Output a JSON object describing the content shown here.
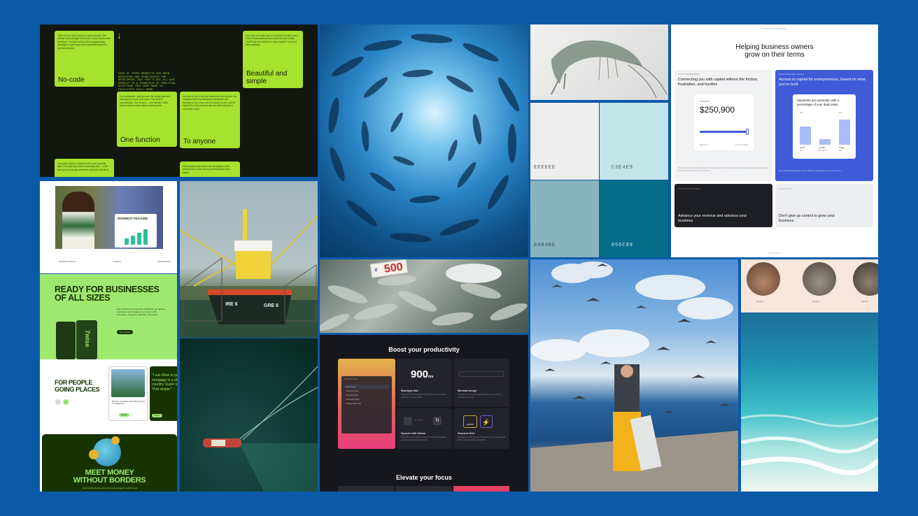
{
  "nocode": {
    "intro_text": "Think of it as Lorem ipsum no-code decoded. The service is the strength of fresh air. Leave it as it is and functional. You don't need to know programming languages to get beyond first a potential client in a convenient place.",
    "card1_title": "No-code",
    "center_text": "EACH OF THESE BENEFITS HAS BEEN DEDICATED AND HIGHLIGHTED FOR DEVELOPERS. BUT THAT'S NOT ALL OUR PRODUCT IS A SYMBIOSIS OF PRACTICAL SOLUTIONS THAT HAVE MADE TO FACILITATE DAILY WORK.",
    "card2_text": "You know, we really tried on all efforts to make sure a brand of best data process solutions a few scripts. You'll Fetch the Platform of mass sample? You don't have anything.",
    "card2_title": "Beautiful and simple",
    "card3_text": "You understand, nothing extra. We simply take and seriously try to use your code of the work to communicate. One service — one function. Each branch-based routine without wasting time.",
    "card3_title": "One function",
    "card4_text": "And that is one of the best features of this product. It is designed both for professional developers and developers who know only the basics of code, just for beginners in the business who are still looking for a successful result.",
    "card4_title": "To anyone",
    "card5_text": "A loophole needs a contact form to work properly, right? The built form adds to manually wait — it will send you a message whenever someone submits it.",
    "card6_text": "With practical experience, the developers of the product have a very strong understanding of the basics."
  },
  "palette": {
    "swatches": [
      {
        "hex": "EEEEEE",
        "color": "#eeeeee",
        "text_color": "#555555"
      },
      {
        "hex": "C3E4E9",
        "color": "#c3e4e9",
        "text_color": "#3d5d63"
      },
      {
        "hex": "88B4BE",
        "color": "#88b4be",
        "text_color": "#2e4d55"
      },
      {
        "hex": "056C89",
        "color": "#056c89",
        "text_color": "#cfe8ee"
      }
    ]
  },
  "capital": {
    "eyebrow": "CAPITAL FINANCE",
    "title_line1": "Helping business owners",
    "title_line2": "grow on their terms",
    "card1_label": "FAST & TRANSPARENT",
    "card1_title": "Connecting you with capital without the friction, frustration, and hurdles",
    "advance_label": "Advance",
    "advance_value": "$250,900",
    "payment_label": "Payment",
    "payment_value": "2.7% of sales",
    "card1_desc": "We connect you with the capital you need to start a few clients, so you can stay focused on growing your business and serving your customers.",
    "card2_label": "REVENUE-BASED CAPITAL",
    "card2_title": "Access to capital for entrepreneurs, based on what you've built",
    "chart_title": "Payments are automatic with a percentage of your daily sales.",
    "bars": [
      {
        "label": "Jul 27",
        "sub": "$24",
        "value": 0.62
      },
      {
        "label": "Jul 28",
        "sub": "$88 / $32.5",
        "value": 0.18
      },
      {
        "label": "Today",
        "sub": "$98",
        "value": 0.85
      }
    ],
    "bar_top_labels": [
      "$24",
      "$98"
    ],
    "card2_desc": "Get capital based entirely on the health of your business, not your score.",
    "card3_label": "HOW WE'RE DIFFERENT",
    "card3_title": "Advance your revenue and advance your business",
    "card4_label": "NO DILUTION",
    "card4_title": "Don't give up control to grow your business",
    "footer": "GET STARTED"
  },
  "wise": {
    "badge_title": "INTEREST FEATURE",
    "stat1": "GROWING WEALTH",
    "stat2": "SAVINGS",
    "stat3": "INVESTMENTS",
    "section2_line1": "READY FOR BUSINESSES",
    "section2_line2": "OF ALL SIZES",
    "section2_desc": "Pay invoices and employees worldwide, get paid as a business and manage your money in 40+ currencies. Trusted by 300,000+ businesses.",
    "section2_button": "Get started",
    "card_brand": "7wise",
    "section3_line1": "FOR PEOPLE",
    "section3_line2": "GOING PLACES",
    "quote": "\"I use Wise to pay my mortgage in a different country. Super simple. That simple.\"",
    "profile_text": "Why live somewhere else without paying a mortgage fee",
    "profile_button": "Explore",
    "small_button": "Explore",
    "section4_line1": "MEET MONEY",
    "section4_line2": "WITHOUT BORDERS",
    "section4_desc": "We're building the best way to move and manage the world's money."
  },
  "trawler": {
    "hull_text1": "IRE 6",
    "hull_text2": "GRE 6"
  },
  "market": {
    "price_tag": "500",
    "price_prefix": "¥"
  },
  "productivity": {
    "title": "Boost your productivity",
    "speed_value": "900",
    "speed_unit": "ms",
    "cell1_title": "Blazingly fast",
    "cell1_desc": "Create to-do at the speed of light. Press a command and write. It's that simple.",
    "cell2_title": "Minimal design",
    "cell2_desc": "You just need one shortcut for filtering your to-do or creating new ones.",
    "cell3_title": "Synced with Notion",
    "cell3_desc": "Everything you create is stored in a Notion database you can extend and customise.",
    "cell4_title": "Shortcut first",
    "cell4_desc": "Flappdeck is built on top of Raycast, so you can access all the power of built-in shortcuts.",
    "key_label": "option",
    "search_placeholder": "Search for todos",
    "menu_items": [
      "Active todos",
      "Upcoming todos",
      "Important todos",
      "Completed todos",
      "Change Notion DB"
    ],
    "section2_title": "Elevate your focus"
  },
  "beach": {
    "card_labels": [
      "Explore",
      "Explore",
      "Explore"
    ]
  },
  "colors": {
    "background": "#0b5aa8",
    "wise_green": "#9fe870",
    "wise_dark": "#163300",
    "lime": "#a6e22e",
    "capital_blue": "#3f5bd8"
  }
}
